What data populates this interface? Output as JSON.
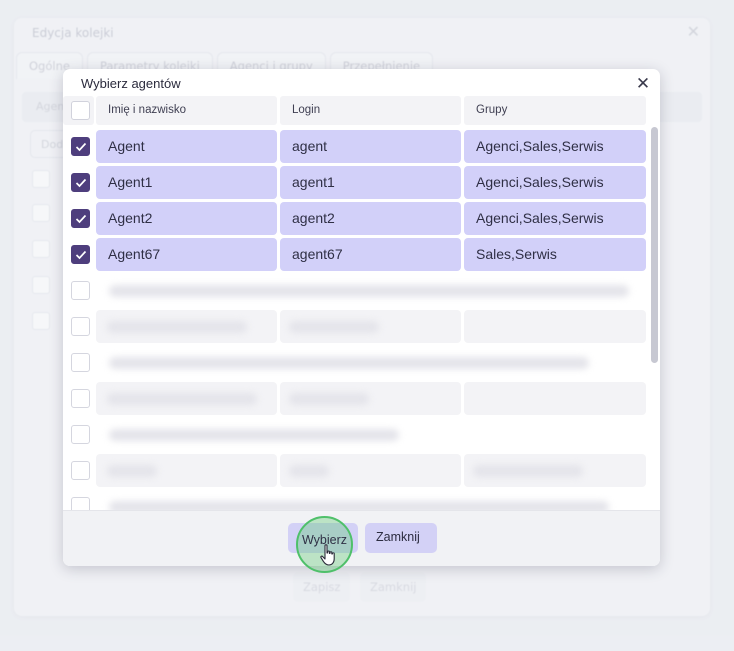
{
  "background_dialog": {
    "title": "Edycja kolejki",
    "close_glyph": "✕",
    "tabs": [
      "Ogólne",
      "Parametry kolejki",
      "Agenci i grupy",
      "Przepełnienie"
    ],
    "header_text": "Agen",
    "add_button_label": "Dod",
    "save_label": "Zapisz",
    "close_label": "Zamknij"
  },
  "modal": {
    "title": "Wybierz agentów",
    "close_glyph": "✕",
    "columns": [
      "Imię i nazwisko",
      "Login",
      "Grupy"
    ],
    "rows": [
      {
        "name": "Agent",
        "login": "agent",
        "groups": "Agenci,Sales,Serwis",
        "checked": true
      },
      {
        "name": "Agent1",
        "login": "agent1",
        "groups": "Agenci,Sales,Serwis",
        "checked": true
      },
      {
        "name": "Agent2",
        "login": "agent2",
        "groups": "Agenci,Sales,Serwis",
        "checked": true
      },
      {
        "name": "Agent67",
        "login": "agent67",
        "groups": "Sales,Serwis",
        "checked": true
      }
    ],
    "select_button": "Wybierz",
    "close_button": "Zamknij"
  },
  "icons": {
    "checkbox": "check-icon",
    "close": "close-icon",
    "cursor": "hand-pointer-icon"
  },
  "colors": {
    "selected_row": "#d2d0f9",
    "checkbox_checked": "#4e3e7d",
    "button": "#d3d1f6",
    "click_ring": "#4fc06a"
  }
}
